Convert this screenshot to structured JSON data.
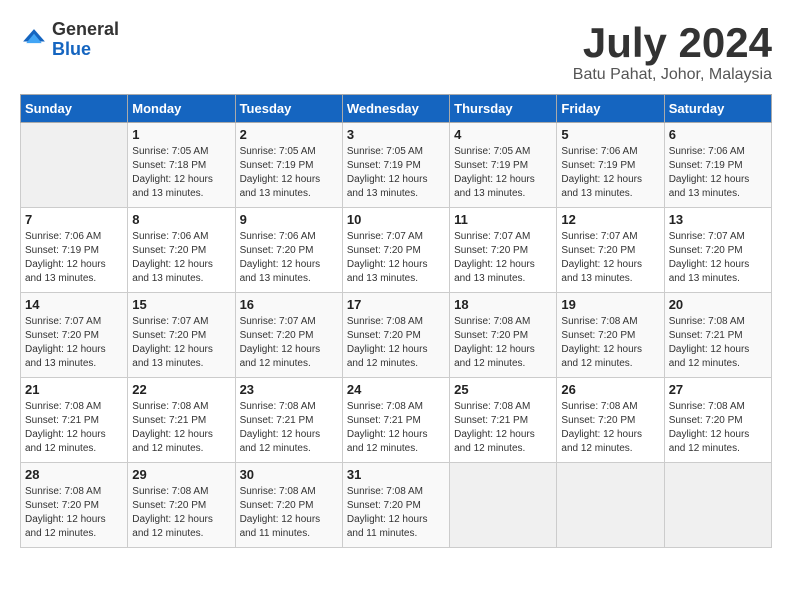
{
  "header": {
    "logo_line1": "General",
    "logo_line2": "Blue",
    "month": "July 2024",
    "location": "Batu Pahat, Johor, Malaysia"
  },
  "weekdays": [
    "Sunday",
    "Monday",
    "Tuesday",
    "Wednesday",
    "Thursday",
    "Friday",
    "Saturday"
  ],
  "weeks": [
    [
      {
        "day": "",
        "sunrise": "",
        "sunset": "",
        "daylight": ""
      },
      {
        "day": "1",
        "sunrise": "7:05 AM",
        "sunset": "7:18 PM",
        "daylight": "12 hours and 13 minutes."
      },
      {
        "day": "2",
        "sunrise": "7:05 AM",
        "sunset": "7:19 PM",
        "daylight": "12 hours and 13 minutes."
      },
      {
        "day": "3",
        "sunrise": "7:05 AM",
        "sunset": "7:19 PM",
        "daylight": "12 hours and 13 minutes."
      },
      {
        "day": "4",
        "sunrise": "7:05 AM",
        "sunset": "7:19 PM",
        "daylight": "12 hours and 13 minutes."
      },
      {
        "day": "5",
        "sunrise": "7:06 AM",
        "sunset": "7:19 PM",
        "daylight": "12 hours and 13 minutes."
      },
      {
        "day": "6",
        "sunrise": "7:06 AM",
        "sunset": "7:19 PM",
        "daylight": "12 hours and 13 minutes."
      }
    ],
    [
      {
        "day": "7",
        "sunrise": "7:06 AM",
        "sunset": "7:19 PM",
        "daylight": "12 hours and 13 minutes."
      },
      {
        "day": "8",
        "sunrise": "7:06 AM",
        "sunset": "7:20 PM",
        "daylight": "12 hours and 13 minutes."
      },
      {
        "day": "9",
        "sunrise": "7:06 AM",
        "sunset": "7:20 PM",
        "daylight": "12 hours and 13 minutes."
      },
      {
        "day": "10",
        "sunrise": "7:07 AM",
        "sunset": "7:20 PM",
        "daylight": "12 hours and 13 minutes."
      },
      {
        "day": "11",
        "sunrise": "7:07 AM",
        "sunset": "7:20 PM",
        "daylight": "12 hours and 13 minutes."
      },
      {
        "day": "12",
        "sunrise": "7:07 AM",
        "sunset": "7:20 PM",
        "daylight": "12 hours and 13 minutes."
      },
      {
        "day": "13",
        "sunrise": "7:07 AM",
        "sunset": "7:20 PM",
        "daylight": "12 hours and 13 minutes."
      }
    ],
    [
      {
        "day": "14",
        "sunrise": "7:07 AM",
        "sunset": "7:20 PM",
        "daylight": "12 hours and 13 minutes."
      },
      {
        "day": "15",
        "sunrise": "7:07 AM",
        "sunset": "7:20 PM",
        "daylight": "12 hours and 13 minutes."
      },
      {
        "day": "16",
        "sunrise": "7:07 AM",
        "sunset": "7:20 PM",
        "daylight": "12 hours and 12 minutes."
      },
      {
        "day": "17",
        "sunrise": "7:08 AM",
        "sunset": "7:20 PM",
        "daylight": "12 hours and 12 minutes."
      },
      {
        "day": "18",
        "sunrise": "7:08 AM",
        "sunset": "7:20 PM",
        "daylight": "12 hours and 12 minutes."
      },
      {
        "day": "19",
        "sunrise": "7:08 AM",
        "sunset": "7:20 PM",
        "daylight": "12 hours and 12 minutes."
      },
      {
        "day": "20",
        "sunrise": "7:08 AM",
        "sunset": "7:21 PM",
        "daylight": "12 hours and 12 minutes."
      }
    ],
    [
      {
        "day": "21",
        "sunrise": "7:08 AM",
        "sunset": "7:21 PM",
        "daylight": "12 hours and 12 minutes."
      },
      {
        "day": "22",
        "sunrise": "7:08 AM",
        "sunset": "7:21 PM",
        "daylight": "12 hours and 12 minutes."
      },
      {
        "day": "23",
        "sunrise": "7:08 AM",
        "sunset": "7:21 PM",
        "daylight": "12 hours and 12 minutes."
      },
      {
        "day": "24",
        "sunrise": "7:08 AM",
        "sunset": "7:21 PM",
        "daylight": "12 hours and 12 minutes."
      },
      {
        "day": "25",
        "sunrise": "7:08 AM",
        "sunset": "7:21 PM",
        "daylight": "12 hours and 12 minutes."
      },
      {
        "day": "26",
        "sunrise": "7:08 AM",
        "sunset": "7:20 PM",
        "daylight": "12 hours and 12 minutes."
      },
      {
        "day": "27",
        "sunrise": "7:08 AM",
        "sunset": "7:20 PM",
        "daylight": "12 hours and 12 minutes."
      }
    ],
    [
      {
        "day": "28",
        "sunrise": "7:08 AM",
        "sunset": "7:20 PM",
        "daylight": "12 hours and 12 minutes."
      },
      {
        "day": "29",
        "sunrise": "7:08 AM",
        "sunset": "7:20 PM",
        "daylight": "12 hours and 12 minutes."
      },
      {
        "day": "30",
        "sunrise": "7:08 AM",
        "sunset": "7:20 PM",
        "daylight": "12 hours and 11 minutes."
      },
      {
        "day": "31",
        "sunrise": "7:08 AM",
        "sunset": "7:20 PM",
        "daylight": "12 hours and 11 minutes."
      },
      {
        "day": "",
        "sunrise": "",
        "sunset": "",
        "daylight": ""
      },
      {
        "day": "",
        "sunrise": "",
        "sunset": "",
        "daylight": ""
      },
      {
        "day": "",
        "sunrise": "",
        "sunset": "",
        "daylight": ""
      }
    ]
  ],
  "labels": {
    "sunrise": "Sunrise:",
    "sunset": "Sunset:",
    "daylight": "Daylight:"
  }
}
